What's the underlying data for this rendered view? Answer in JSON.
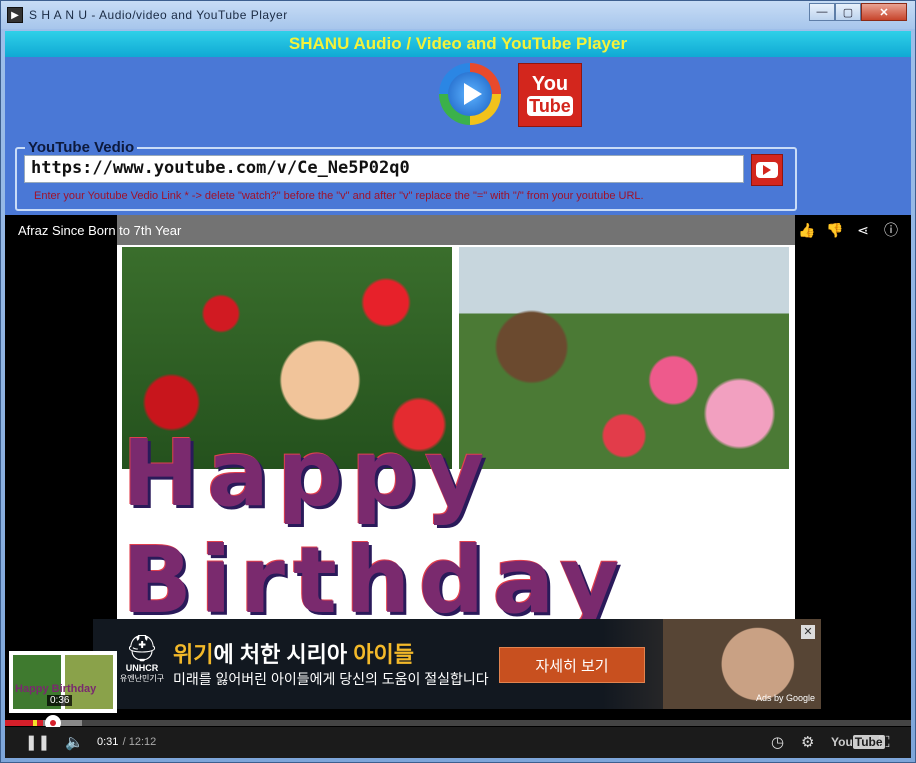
{
  "window": {
    "title": "S H A N U - Audio/video and YouTube Player",
    "minimize": "—",
    "maximize": "▢",
    "close": "✕"
  },
  "header": {
    "title": "SHANU Audio / Video and YouTube Player"
  },
  "logos": {
    "youtube_l1": "You",
    "youtube_l2": "Tube"
  },
  "url_section": {
    "legend": "YouTube Vedio",
    "url_value": "https://www.youtube.com/v/Ce_Ne5P02q0",
    "hint": "Enter your Youtube Vedio Link * -> delete \"watch?\" before the \"v\" and after \"v\" replace the \"=\" with  \"/\" from your youtube URL."
  },
  "video": {
    "title": "Afraz Since Born to 7th Year",
    "overlay_text": "Happy Birthday"
  },
  "ad": {
    "headline_part1": "위기",
    "headline_part2": "에 처한 시리아 ",
    "headline_part3": "아이들",
    "subline": "미래를 잃어버린 아이들에게 당신의 도움이 절실합니다",
    "cta": "자세히 보기",
    "logo_name": "UNHCR",
    "logo_kr": "유엔난민기구",
    "ads_by": "Ads by Google",
    "close": "✕"
  },
  "preview": {
    "text": "Happy Birthday",
    "time": "0:36"
  },
  "controls": {
    "current_time": "0:31",
    "duration": "/ 12:12",
    "youtube_brand_1": "You",
    "youtube_brand_2": "Tube",
    "played_fraction": 0.042,
    "buffered_fraction": 0.085
  },
  "colors": {
    "header_title": "#f4f23a",
    "hint": "#a0122a",
    "progress_played": "#d51f2a"
  }
}
